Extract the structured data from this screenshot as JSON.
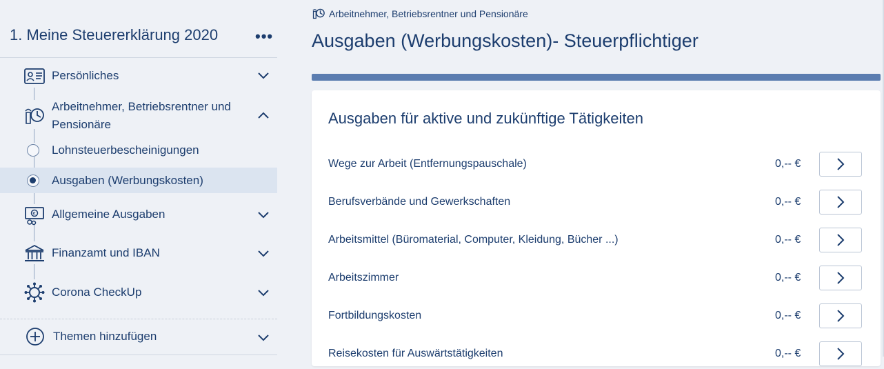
{
  "sidebar": {
    "title": "1. Meine Steuererklärung 2020",
    "menu_icon": "more-dots-icon",
    "items": [
      {
        "label": "Persönliches",
        "icon": "id-card-icon"
      },
      {
        "label": "Arbeitnehmer, Betriebsrentner und",
        "label2": "Pensionäre",
        "icon": "worker-clock-icon"
      },
      {
        "label": "Lohnsteuerbescheinigungen",
        "icon": "radio-empty-icon"
      },
      {
        "label": "Ausgaben (Werbungskosten)",
        "icon": "radio-selected-icon"
      },
      {
        "label": "Allgemeine Ausgaben",
        "icon": "money-icon"
      },
      {
        "label": "Finanzamt und IBAN",
        "icon": "bank-icon"
      },
      {
        "label": "Corona CheckUp",
        "icon": "virus-icon"
      },
      {
        "label": "Themen hinzufügen",
        "icon": "plus-circle-icon"
      }
    ]
  },
  "breadcrumb": {
    "text": "Arbeitnehmer, Betriebsrentner und Pensionäre",
    "icon": "worker-clock-icon"
  },
  "main": {
    "title": "Ausgaben (Werbungskosten)- Steuerpflichtiger",
    "card_title": "Ausgaben für aktive und zukünftige Tätigkeiten",
    "rows": [
      {
        "label": "Wege zur Arbeit (Entfernungspauschale)",
        "value": "0,-- €"
      },
      {
        "label": "Berufsverbände und Gewerkschaften",
        "value": "0,-- €"
      },
      {
        "label": "Arbeitsmittel (Büromaterial, Computer, Kleidung, Bücher ...)",
        "value": "0,-- €"
      },
      {
        "label": "Arbeitszimmer",
        "value": "0,-- €"
      },
      {
        "label": "Fortbildungskosten",
        "value": "0,-- €"
      },
      {
        "label": "Reisekosten für Auswärtstätigkeiten",
        "value": "0,-- €"
      }
    ]
  },
  "colors": {
    "primary": "#1c3d6e",
    "accent_bar": "#5b7db0",
    "background": "#eef1f6",
    "active_item": "#dbe4f0"
  }
}
